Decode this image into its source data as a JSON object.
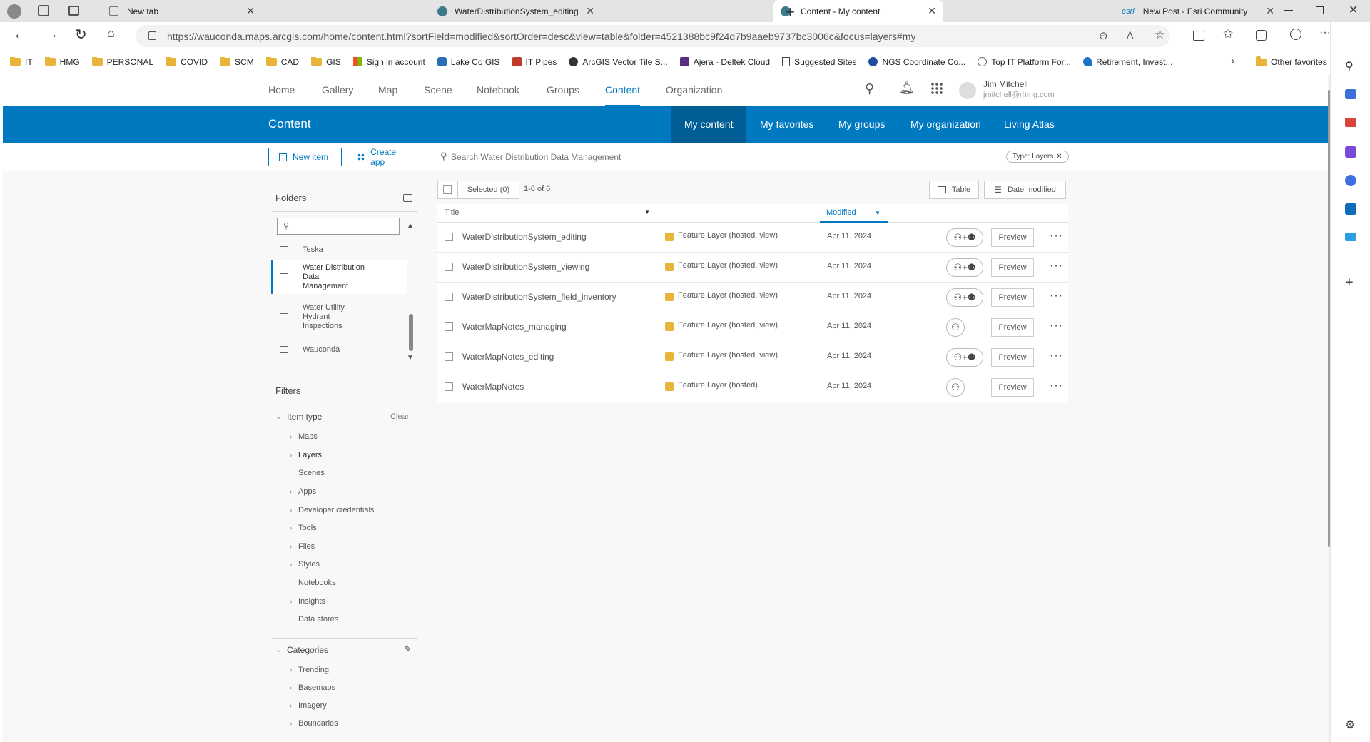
{
  "browser": {
    "tabs": [
      {
        "title": "New tab"
      },
      {
        "title": "WaterDistributionSystem_editing"
      },
      {
        "title": "Content - My content"
      },
      {
        "title": "New Post - Esri Community",
        "prefix": "esri"
      }
    ],
    "url": "https://wauconda.maps.arcgis.com/home/content.html?sortField=modified&sortOrder=desc&view=table&folder=4521388bc9f24d7b9aaeb9737bc3006c&focus=layers#my",
    "bookmarks": [
      "IT",
      "HMG",
      "PERSONAL",
      "COVID",
      "SCM",
      "CAD",
      "GIS",
      "Sign in account",
      "Lake Co GIS",
      "IT Pipes",
      "ArcGIS Vector Tile S...",
      "Ajera - Deltek Cloud",
      "Suggested Sites",
      "NGS Coordinate Co...",
      "Top IT Platform For...",
      "Retirement, Invest..."
    ],
    "other_favorites": "Other favorites"
  },
  "nav": {
    "items": [
      "Home",
      "Gallery",
      "Map",
      "Scene",
      "Notebook",
      "Groups",
      "Content",
      "Organization"
    ],
    "user_name": "Jim Mitchell",
    "user_email": "jmitchell@rhmg.com"
  },
  "content_bar": {
    "title": "Content",
    "tabs": [
      "My content",
      "My favorites",
      "My groups",
      "My organization",
      "Living Atlas"
    ]
  },
  "toolbar": {
    "new_item": "New item",
    "create_app": "Create app",
    "search_placeholder": "Search Water Distribution Data Management",
    "filter_chip": "Type: Layers"
  },
  "folders": {
    "heading": "Folders",
    "items": [
      {
        "name": "Teska"
      },
      {
        "name": "Water Distribution Data Management"
      },
      {
        "name": "Water Utility Hydrant Inspections"
      },
      {
        "name": "Wauconda"
      }
    ]
  },
  "filters": {
    "heading": "Filters",
    "item_type": "Item type",
    "clear": "Clear",
    "types": [
      "Maps",
      "Layers",
      "Scenes",
      "Apps",
      "Developer credentials",
      "Tools",
      "Files",
      "Styles",
      "Notebooks",
      "Insights",
      "Data stores"
    ],
    "categories_heading": "Categories",
    "categories": [
      "Trending",
      "Basemaps",
      "Imagery",
      "Boundaries"
    ]
  },
  "table": {
    "selected": "Selected (0)",
    "count": "1-6 of 6",
    "view_label": "Table",
    "sort_label": "Date modified",
    "col_title": "Title",
    "col_modified": "Modified",
    "preview_label": "Preview",
    "rows": [
      {
        "title": "WaterDistributionSystem_editing",
        "type": "Feature Layer (hosted, view)",
        "modified": "Apr 11, 2024"
      },
      {
        "title": "WaterDistributionSystem_viewing",
        "type": "Feature Layer (hosted, view)",
        "modified": "Apr 11, 2024"
      },
      {
        "title": "WaterDistributionSystem_field_inventory",
        "type": "Feature Layer (hosted, view)",
        "modified": "Apr 11, 2024"
      },
      {
        "title": "WaterMapNotes_managing",
        "type": "Feature Layer (hosted, view)",
        "modified": "Apr 11, 2024"
      },
      {
        "title": "WaterMapNotes_editing",
        "type": "Feature Layer (hosted, view)",
        "modified": "Apr 11, 2024"
      },
      {
        "title": "WaterMapNotes",
        "type": "Feature Layer (hosted)",
        "modified": "Apr 11, 2024"
      }
    ]
  },
  "colors": {
    "brand_blue": "#0079c1",
    "active_blue": "#005e95"
  }
}
